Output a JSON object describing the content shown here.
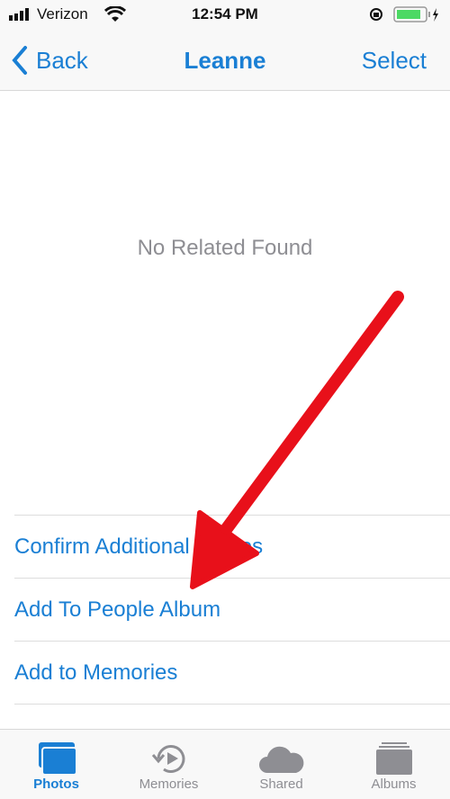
{
  "status_bar": {
    "carrier": "Verizon",
    "time": "12:54 PM",
    "battery_color": "#4cd964"
  },
  "nav": {
    "back_label": "Back",
    "title": "Leanne",
    "select_label": "Select"
  },
  "empty_message": "No Related Found",
  "actions": [
    {
      "label": "Confirm Additional Photos"
    },
    {
      "label": "Add To People Album"
    },
    {
      "label": "Add to Memories"
    }
  ],
  "tabs": [
    {
      "label": "Photos",
      "icon": "photos-icon",
      "active": true
    },
    {
      "label": "Memories",
      "icon": "memories-icon"
    },
    {
      "label": "Shared",
      "icon": "cloud-icon"
    },
    {
      "label": "Albums",
      "icon": "albums-icon"
    }
  ],
  "colors": {
    "accent": "#1a7fd4",
    "annotation_arrow": "#e8101a"
  }
}
